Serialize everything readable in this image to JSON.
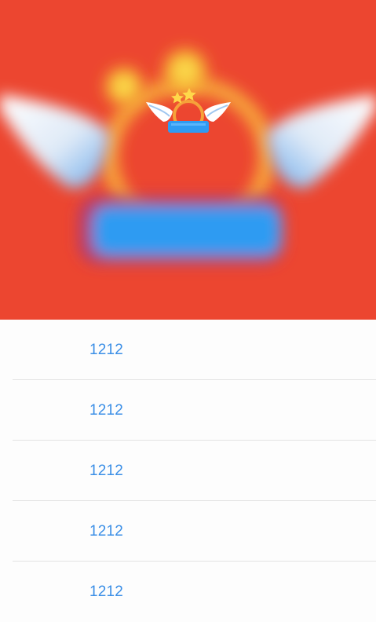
{
  "hero": {
    "background_color": "#ec4630",
    "image": "winged-badge-illustration",
    "colors": {
      "orb": "#fbd23a",
      "wing": "#ffffff",
      "wing_shadow": "#9fc7f0",
      "banner": "#2f9bf2",
      "ring": "#f6a23a",
      "star": "#ffd84a"
    }
  },
  "list": {
    "items": [
      {
        "label": "1212"
      },
      {
        "label": "1212"
      },
      {
        "label": "1212"
      },
      {
        "label": "1212"
      },
      {
        "label": "1212"
      }
    ]
  },
  "colors": {
    "link_text": "#3a8ee6",
    "separator": "#e2e2e2",
    "list_background": "#fdfdfd"
  }
}
